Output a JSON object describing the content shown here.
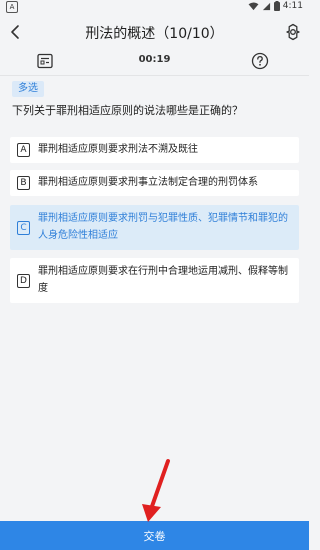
{
  "status_bar": {
    "app_letter": "A",
    "time": "4:11"
  },
  "header": {
    "title": "刑法的概述（10/10）"
  },
  "toolbar": {
    "timer": "00:19"
  },
  "question": {
    "type_badge": "多选",
    "text": "下列关于罪刑相适应原则的说法哪些是正确的？"
  },
  "options": [
    {
      "letter": "A",
      "text": "罪刑相适应原则要求刑法不溯及既往",
      "selected": false
    },
    {
      "letter": "B",
      "text": "罪刑相适应原则要求刑事立法制定合理的刑罚体系",
      "selected": false
    },
    {
      "letter": "C",
      "text": "罪刑相适应原则要求刑罚与犯罪性质、犯罪情节和罪犯的人身危险性相适应",
      "selected": true
    },
    {
      "letter": "D",
      "text": "罪刑相适应原则要求在行刑中合理地运用减刑、假释等制度",
      "selected": false
    }
  ],
  "footer": {
    "submit_label": "交卷"
  },
  "colors": {
    "accent": "#2e86e6",
    "selected_bg": "#dcebf8",
    "annotation_arrow": "#e02020"
  }
}
